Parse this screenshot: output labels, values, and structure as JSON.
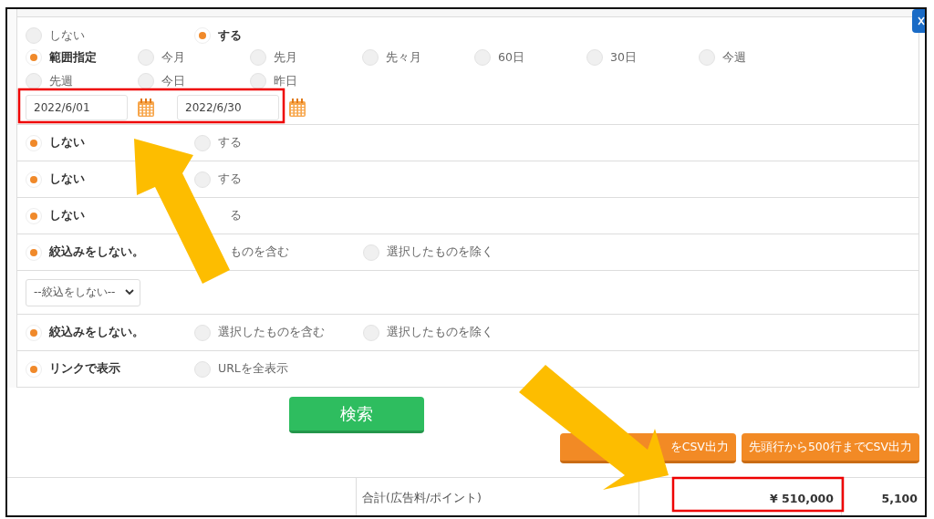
{
  "date_filter": {
    "toggle": [
      {
        "label": "しない",
        "selected": false
      },
      {
        "label": "する",
        "selected": true
      }
    ],
    "ranges": [
      {
        "label": "範囲指定",
        "selected": true
      },
      {
        "label": "今月",
        "selected": false
      },
      {
        "label": "先月",
        "selected": false
      },
      {
        "label": "先々月",
        "selected": false
      },
      {
        "label": "60日",
        "selected": false
      },
      {
        "label": "30日",
        "selected": false
      },
      {
        "label": "今週",
        "selected": false
      },
      {
        "label": "先週",
        "selected": false
      },
      {
        "label": "今日",
        "selected": false
      },
      {
        "label": "昨日",
        "selected": false
      }
    ],
    "date_from": {
      "value": "2022/6/01"
    },
    "date_to": {
      "value": "2022/6/30"
    }
  },
  "option_rows": [
    {
      "kind": "radio",
      "options": [
        {
          "label": "しない",
          "selected": true
        },
        {
          "label": "する",
          "selected": false
        }
      ]
    },
    {
      "kind": "radio",
      "options": [
        {
          "label": "しない",
          "selected": true
        },
        {
          "label": "する",
          "selected": false
        }
      ]
    },
    {
      "kind": "radio",
      "options": [
        {
          "label": "しない",
          "selected": true
        },
        {
          "kind": "partial",
          "label": "る"
        }
      ]
    },
    {
      "kind": "radio",
      "options": [
        {
          "label": "絞込みをしない。",
          "selected": true
        },
        {
          "kind": "partial",
          "label": "ものを含む"
        },
        {
          "label": "選択したものを除く",
          "selected": false
        }
      ]
    },
    {
      "kind": "select",
      "value": "--絞込をしない--"
    },
    {
      "kind": "radio",
      "options": [
        {
          "label": "絞込みをしない。",
          "selected": true
        },
        {
          "label": "選択したものを含む",
          "selected": false
        },
        {
          "label": "選択したものを除く",
          "selected": false
        }
      ]
    },
    {
      "kind": "radio",
      "options": [
        {
          "label": "リンクで表示",
          "selected": true
        },
        {
          "label": "URLを全表示",
          "selected": false
        }
      ]
    }
  ],
  "search_button": "検索",
  "csv_buttons": [
    "をCSV出力",
    "先頭行から500行までCSV出力"
  ],
  "totals_row": {
    "label": "合計(広告料/ポイント)",
    "amount": "¥ 510,000",
    "points": "5,100"
  }
}
